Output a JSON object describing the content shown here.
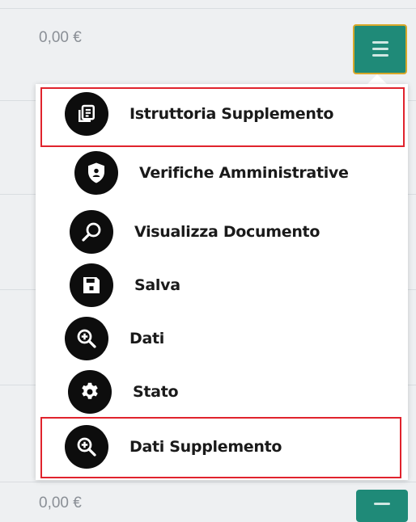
{
  "rows": {
    "top_amount": "0,00 €",
    "bottom_amount": "0,00 €"
  },
  "actions_menu": {
    "items": [
      {
        "label": "Istruttoria Supplemento",
        "icon": "document-list-icon",
        "highlighted": true
      },
      {
        "label": "Verifiche Amministrative",
        "icon": "shield-user-icon",
        "highlighted": false
      },
      {
        "label": "Visualizza Documento",
        "icon": "magnifier-icon",
        "highlighted": false
      },
      {
        "label": "Salva",
        "icon": "floppy-disk-icon",
        "highlighted": false
      },
      {
        "label": "Dati",
        "icon": "zoom-in-icon",
        "highlighted": false
      },
      {
        "label": "Stato",
        "icon": "gear-icon",
        "highlighted": false
      },
      {
        "label": "Dati Supplemento",
        "icon": "zoom-in-icon",
        "highlighted": true
      }
    ]
  },
  "colors": {
    "toggle_bg": "#1f8a78",
    "toggle_border": "#d8a82a",
    "highlight_border": "#e0232d",
    "icon_bg": "#0d0d0d"
  }
}
